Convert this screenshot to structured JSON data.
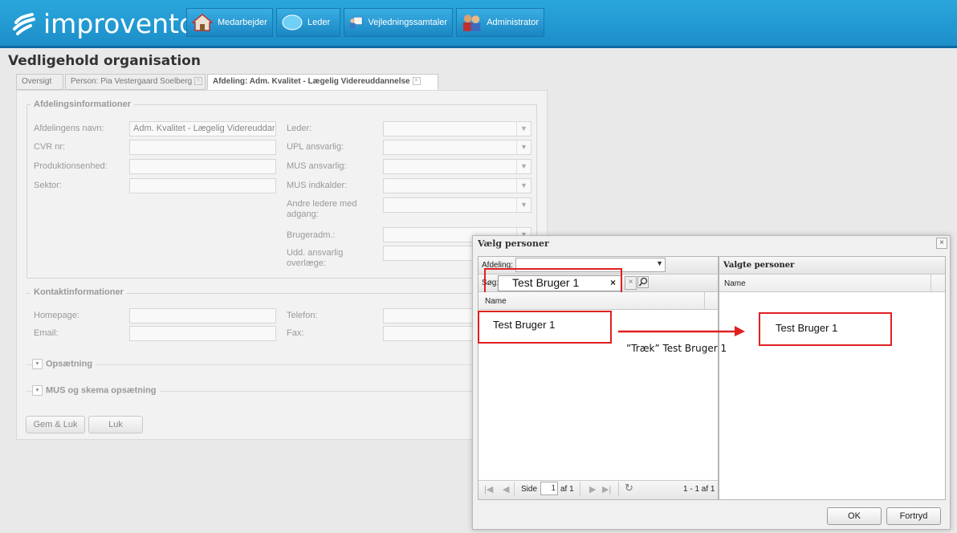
{
  "brand": {
    "name": "improvento"
  },
  "nav": [
    {
      "label": "Medarbejder",
      "icon": "house-icon"
    },
    {
      "label": "Leder",
      "icon": "chat-bubble-icon"
    },
    {
      "label": "Vejledningssamtaler",
      "icon": "person-board-icon"
    },
    {
      "label": "Administrator",
      "icon": "people-icon"
    }
  ],
  "page": {
    "title": "Vedligehold organisation"
  },
  "tabs": [
    {
      "label": "Oversigt"
    },
    {
      "label": "Person: Pia Vestergaard Soelberg"
    },
    {
      "label": "Afdeling: Adm. Kvalitet - Lægelig Videreuddannelse"
    }
  ],
  "afdeling": {
    "legend": "Afdelingsinformationer",
    "fields": {
      "navn_label": "Afdelingens navn:",
      "navn_value": "Adm. Kvalitet - Lægelig Videreuddar",
      "cvr_label": "CVR nr:",
      "produktion_label": "Produktionsenhed:",
      "sektor_label": "Sektor:",
      "leder_label": "Leder:",
      "upl_label": "UPL ansvarlig:",
      "mus_ansvarlig_label": "MUS ansvarlig:",
      "mus_indkalder_label": "MUS indkalder:",
      "andre_label": "Andre ledere med adgang:",
      "brugeradm_label": "Brugeradm.:",
      "udd_label": "Udd. ansvarlig overlæge:"
    }
  },
  "kontakt": {
    "legend": "Kontaktinformationer",
    "homepage_label": "Homepage:",
    "email_label": "Email:",
    "telefon_label": "Telefon:",
    "fax_label": "Fax:"
  },
  "sections": {
    "opsaetning": "Opsætning",
    "mus": "MUS og skema opsætning"
  },
  "buttons": {
    "gem_luk": "Gem & Luk",
    "luk": "Luk"
  },
  "dialog": {
    "title": "Vælg personer",
    "afdeling_label": "Afdeling:",
    "search_label": "Søg:",
    "search_value": "Test Bruger 1",
    "name_col": "Name",
    "result_row": "Test Bruger 1",
    "selected_header": "Valgte personer",
    "selected_name_col": "Name",
    "selected_row": "Test Bruger 1",
    "drag_annotation": "”Træk” Test Bruger 1",
    "pager": {
      "side_label": "Side",
      "page_value": "1",
      "af_label": "af 1",
      "range": "1 - 1 af 1"
    },
    "ok": "OK",
    "cancel": "Fortryd"
  },
  "colors": {
    "header": "#1c8dc8",
    "highlight": "#e02020"
  }
}
